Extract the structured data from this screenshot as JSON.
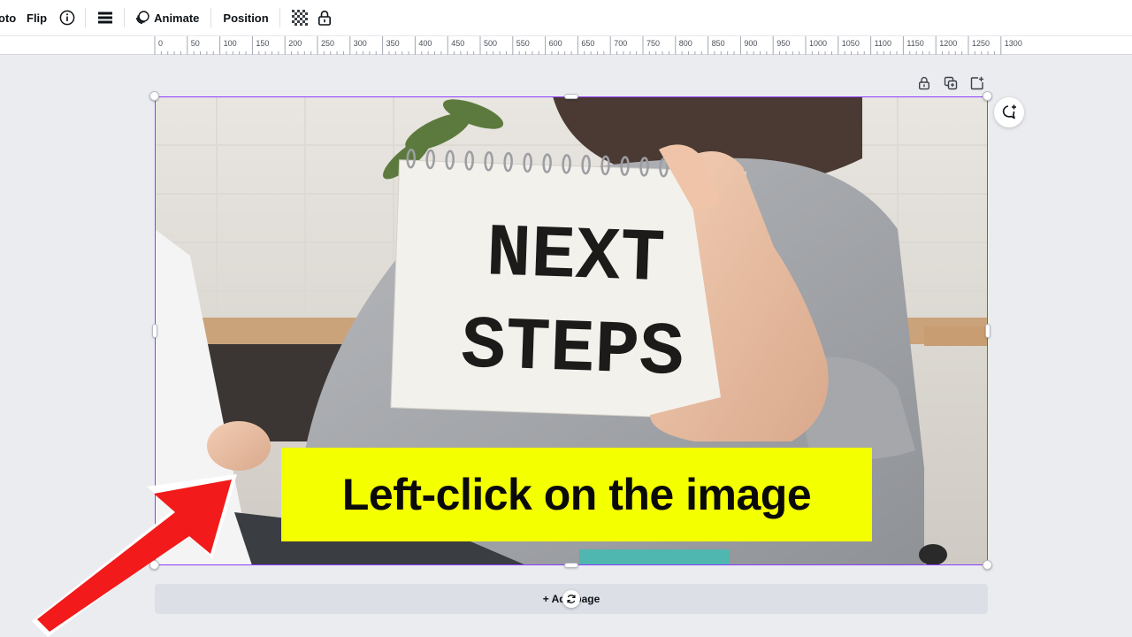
{
  "toolbar": {
    "photo_label": "oto",
    "flip_label": "Flip",
    "info_icon": "info-icon",
    "spacing_icon": "line-spacing-icon",
    "animate_label": "Animate",
    "animate_icon": "animate-icon",
    "position_label": "Position",
    "transparency_icon": "transparency-icon",
    "lock_icon": "lock-icon"
  },
  "ruler": {
    "ticks": [
      "0",
      "50",
      "100",
      "150",
      "200",
      "250",
      "300",
      "350",
      "400",
      "450",
      "500",
      "550",
      "600",
      "650",
      "700",
      "750",
      "800",
      "850",
      "900",
      "950",
      "1000",
      "1050",
      "1100",
      "1150",
      "1200",
      "1250",
      "1300"
    ]
  },
  "page_actions": [
    "lock-icon",
    "duplicate-page-icon",
    "add-page-icon"
  ],
  "image": {
    "notepad_line1": "NEXT",
    "notepad_line2": "STEPS"
  },
  "callout": {
    "text": "Left-click on the image",
    "color": "#f4ff00"
  },
  "add_page": {
    "label": "+ Add page"
  },
  "colors": {
    "selection": "#8b3dff",
    "arrow": "#f21a1a"
  }
}
